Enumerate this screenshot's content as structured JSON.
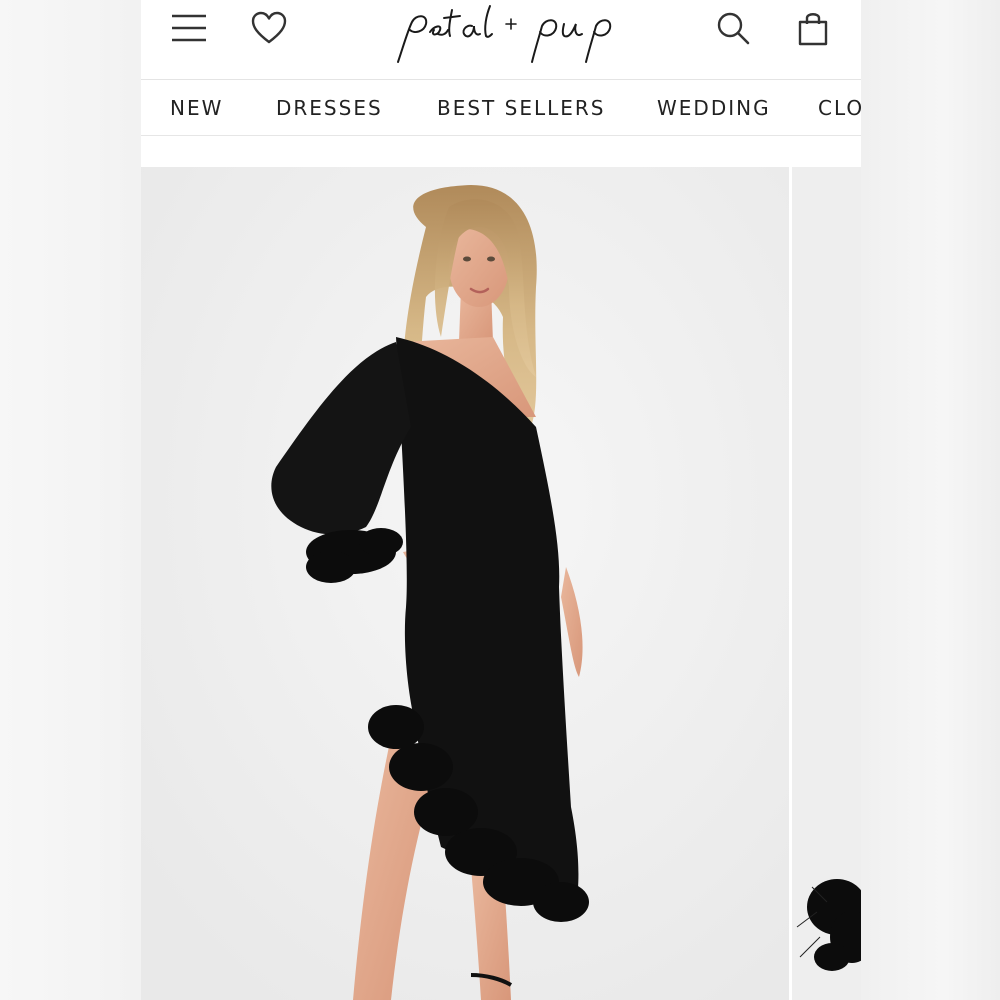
{
  "brand": {
    "logo_text": "petal + pup"
  },
  "header": {
    "menu_icon": "hamburger-menu-icon",
    "wishlist_icon": "heart-icon",
    "search_icon": "search-icon",
    "cart_icon": "shopping-bag-icon"
  },
  "nav": {
    "items": [
      "NEW",
      "DRESSES",
      "BEST SELLERS",
      "WEDDING",
      "CLO"
    ]
  },
  "gallery": {
    "images": [
      {
        "description": "model wearing black one-shoulder midi dress with feather trim",
        "dress_color": "#111111"
      },
      {
        "description": "next product image partially visible"
      }
    ]
  },
  "colors": {
    "background": "#ffffff",
    "text": "#222222",
    "dress": "#111111"
  }
}
